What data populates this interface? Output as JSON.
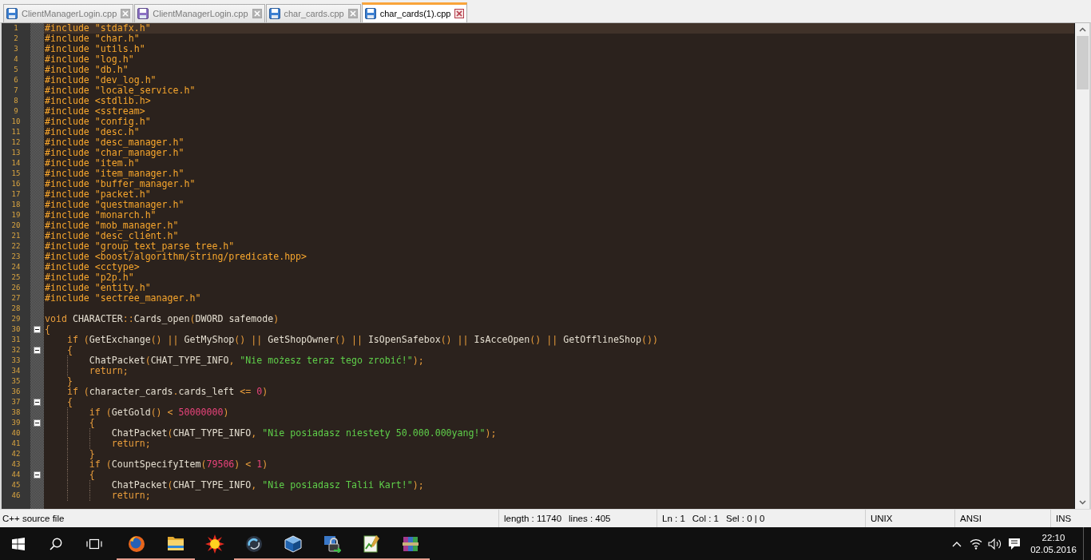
{
  "tabs": [
    {
      "label": "ClientManagerLogin.cpp",
      "selected": false,
      "read_only": false
    },
    {
      "label": "ClientManagerLogin.cpp",
      "selected": false,
      "read_only": true
    },
    {
      "label": "char_cards.cpp",
      "selected": false,
      "read_only": false
    },
    {
      "label": "char_cards(1).cpp",
      "selected": true,
      "read_only": false
    }
  ],
  "editor": {
    "lines": [
      {
        "number": "1",
        "current": true,
        "code": [
          {
            "kind": "preproc",
            "text": "#include \"stdafx.h\""
          }
        ]
      },
      {
        "number": "2",
        "current": false,
        "code": [
          {
            "kind": "preproc",
            "text": "#include \"char.h\""
          }
        ]
      },
      {
        "number": "3",
        "current": false,
        "code": [
          {
            "kind": "preproc",
            "text": "#include \"utils.h\""
          }
        ]
      },
      {
        "number": "4",
        "current": false,
        "code": [
          {
            "kind": "preproc",
            "text": "#include \"log.h\""
          }
        ]
      },
      {
        "number": "5",
        "current": false,
        "code": [
          {
            "kind": "preproc",
            "text": "#include \"db.h\""
          }
        ]
      },
      {
        "number": "6",
        "current": false,
        "code": [
          {
            "kind": "preproc",
            "text": "#include \"dev_log.h\""
          }
        ]
      },
      {
        "number": "7",
        "current": false,
        "code": [
          {
            "kind": "preproc",
            "text": "#include \"locale_service.h\""
          }
        ]
      },
      {
        "number": "8",
        "current": false,
        "code": [
          {
            "kind": "preproc",
            "text": "#include <stdlib.h>"
          }
        ]
      },
      {
        "number": "9",
        "current": false,
        "code": [
          {
            "kind": "preproc",
            "text": "#include <sstream>"
          }
        ]
      },
      {
        "number": "10",
        "current": false,
        "code": [
          {
            "kind": "preproc",
            "text": "#include \"config.h\""
          }
        ]
      },
      {
        "number": "11",
        "current": false,
        "code": [
          {
            "kind": "preproc",
            "text": "#include \"desc.h\""
          }
        ]
      },
      {
        "number": "12",
        "current": false,
        "code": [
          {
            "kind": "preproc",
            "text": "#include \"desc_manager.h\""
          }
        ]
      },
      {
        "number": "13",
        "current": false,
        "code": [
          {
            "kind": "preproc",
            "text": "#include \"char_manager.h\""
          }
        ]
      },
      {
        "number": "14",
        "current": false,
        "code": [
          {
            "kind": "preproc",
            "text": "#include \"item.h\""
          }
        ]
      },
      {
        "number": "15",
        "current": false,
        "code": [
          {
            "kind": "preproc",
            "text": "#include \"item_manager.h\""
          }
        ]
      },
      {
        "number": "16",
        "current": false,
        "code": [
          {
            "kind": "preproc",
            "text": "#include \"buffer_manager.h\""
          }
        ]
      },
      {
        "number": "17",
        "current": false,
        "code": [
          {
            "kind": "preproc",
            "text": "#include \"packet.h\""
          }
        ]
      },
      {
        "number": "18",
        "current": false,
        "code": [
          {
            "kind": "preproc",
            "text": "#include \"questmanager.h\""
          }
        ]
      },
      {
        "number": "19",
        "current": false,
        "code": [
          {
            "kind": "preproc",
            "text": "#include \"monarch.h\""
          }
        ]
      },
      {
        "number": "20",
        "current": false,
        "code": [
          {
            "kind": "preproc",
            "text": "#include \"mob_manager.h\""
          }
        ]
      },
      {
        "number": "21",
        "current": false,
        "code": [
          {
            "kind": "preproc",
            "text": "#include \"desc_client.h\""
          }
        ]
      },
      {
        "number": "22",
        "current": false,
        "code": [
          {
            "kind": "preproc",
            "text": "#include \"group_text_parse_tree.h\""
          }
        ]
      },
      {
        "number": "23",
        "current": false,
        "code": [
          {
            "kind": "preproc",
            "text": "#include <boost/algorithm/string/predicate.hpp>"
          }
        ]
      },
      {
        "number": "24",
        "current": false,
        "code": [
          {
            "kind": "preproc",
            "text": "#include <cctype>"
          }
        ]
      },
      {
        "number": "25",
        "current": false,
        "code": [
          {
            "kind": "preproc",
            "text": "#include \"p2p.h\""
          }
        ]
      },
      {
        "number": "26",
        "current": false,
        "code": [
          {
            "kind": "preproc",
            "text": "#include \"entity.h\""
          }
        ]
      },
      {
        "number": "27",
        "current": false,
        "code": [
          {
            "kind": "preproc",
            "text": "#include \"sectree_manager.h\""
          }
        ]
      },
      {
        "number": "28",
        "current": false
      },
      {
        "number": "29",
        "current": false,
        "code": [
          {
            "kind": "keyword",
            "text": "void"
          },
          {
            "kind": "plain",
            "text": " CHARACTER"
          },
          {
            "kind": "keyword",
            "text": "::"
          },
          {
            "kind": "plain",
            "text": "Cards_open"
          },
          {
            "kind": "keyword",
            "text": "("
          },
          {
            "kind": "plain",
            "text": "DWORD safemode"
          },
          {
            "kind": "keyword",
            "text": ")"
          }
        ]
      },
      {
        "number": "30",
        "current": false,
        "folded": false,
        "code": [
          {
            "kind": "keyword",
            "text": "{"
          }
        ]
      },
      {
        "number": "31",
        "current": false,
        "code": [
          {
            "kind": "keyword",
            "text": "    if ("
          },
          {
            "kind": "plain",
            "text": "GetExchange"
          },
          {
            "kind": "keyword",
            "text": "() || "
          },
          {
            "kind": "plain",
            "text": "GetMyShop"
          },
          {
            "kind": "keyword",
            "text": "() || "
          },
          {
            "kind": "plain",
            "text": "GetShopOwner"
          },
          {
            "kind": "keyword",
            "text": "() || "
          },
          {
            "kind": "plain",
            "text": "IsOpenSafebox"
          },
          {
            "kind": "keyword",
            "text": "() || "
          },
          {
            "kind": "plain",
            "text": "IsAcceOpen"
          },
          {
            "kind": "keyword",
            "text": "() || "
          },
          {
            "kind": "plain",
            "text": "GetOfflineShop"
          },
          {
            "kind": "keyword",
            "text": "())"
          }
        ]
      },
      {
        "number": "32",
        "current": false,
        "folded": false,
        "code": [
          {
            "kind": "keyword",
            "text": "    {"
          }
        ]
      },
      {
        "number": "33",
        "current": false,
        "code": [
          {
            "kind": "plain",
            "text": "        ChatPacket"
          },
          {
            "kind": "keyword",
            "text": "("
          },
          {
            "kind": "plain",
            "text": "CHAT_TYPE_INFO"
          },
          {
            "kind": "keyword",
            "text": ", "
          },
          {
            "kind": "string",
            "text": "\"Nie możesz teraz tego zrobić!\""
          },
          {
            "kind": "keyword",
            "text": ");"
          }
        ]
      },
      {
        "number": "34",
        "current": false,
        "code": [
          {
            "kind": "keyword",
            "text": "        return;"
          }
        ]
      },
      {
        "number": "35",
        "current": false,
        "code": [
          {
            "kind": "keyword",
            "text": "    }"
          }
        ]
      },
      {
        "number": "36",
        "current": false,
        "code": [
          {
            "kind": "keyword",
            "text": "    if ("
          },
          {
            "kind": "plain",
            "text": "character_cards"
          },
          {
            "kind": "keyword",
            "text": "."
          },
          {
            "kind": "plain",
            "text": "cards_left"
          },
          {
            "kind": "keyword",
            "text": " <= "
          },
          {
            "kind": "number",
            "text": "0"
          },
          {
            "kind": "keyword",
            "text": ")"
          }
        ]
      },
      {
        "number": "37",
        "current": false,
        "folded": false,
        "code": [
          {
            "kind": "keyword",
            "text": "    {"
          }
        ]
      },
      {
        "number": "38",
        "current": false,
        "code": [
          {
            "kind": "keyword",
            "text": "        if ("
          },
          {
            "kind": "plain",
            "text": "GetGold"
          },
          {
            "kind": "keyword",
            "text": "() < "
          },
          {
            "kind": "number",
            "text": "50000000"
          },
          {
            "kind": "keyword",
            "text": ")"
          }
        ]
      },
      {
        "number": "39",
        "current": false,
        "folded": false,
        "code": [
          {
            "kind": "keyword",
            "text": "        {"
          }
        ]
      },
      {
        "number": "40",
        "current": false,
        "code": [
          {
            "kind": "plain",
            "text": "            ChatPacket"
          },
          {
            "kind": "keyword",
            "text": "("
          },
          {
            "kind": "plain",
            "text": "CHAT_TYPE_INFO"
          },
          {
            "kind": "keyword",
            "text": ", "
          },
          {
            "kind": "string",
            "text": "\"Nie posiadasz niestety 50.000.000yang!\""
          },
          {
            "kind": "keyword",
            "text": ");"
          }
        ]
      },
      {
        "number": "41",
        "current": false,
        "code": [
          {
            "kind": "keyword",
            "text": "            return;"
          }
        ]
      },
      {
        "number": "42",
        "current": false,
        "code": [
          {
            "kind": "keyword",
            "text": "        }"
          }
        ]
      },
      {
        "number": "43",
        "current": false,
        "code": [
          {
            "kind": "keyword",
            "text": "        if ("
          },
          {
            "kind": "plain",
            "text": "CountSpecifyItem"
          },
          {
            "kind": "keyword",
            "text": "("
          },
          {
            "kind": "number",
            "text": "79506"
          },
          {
            "kind": "keyword",
            "text": ") < "
          },
          {
            "kind": "number",
            "text": "1"
          },
          {
            "kind": "keyword",
            "text": ")"
          }
        ]
      },
      {
        "number": "44",
        "current": false,
        "folded": false,
        "code": [
          {
            "kind": "keyword",
            "text": "        {"
          }
        ]
      },
      {
        "number": "45",
        "current": false,
        "code": [
          {
            "kind": "plain",
            "text": "            ChatPacket"
          },
          {
            "kind": "keyword",
            "text": "("
          },
          {
            "kind": "plain",
            "text": "CHAT_TYPE_INFO"
          },
          {
            "kind": "keyword",
            "text": ", "
          },
          {
            "kind": "string",
            "text": "\"Nie posiadasz Talii Kart!\""
          },
          {
            "kind": "keyword",
            "text": ");"
          }
        ]
      },
      {
        "number": "46",
        "current": false,
        "code": [
          {
            "kind": "keyword",
            "text": "            return;"
          }
        ]
      }
    ]
  },
  "status_bar": {
    "sections": [
      {
        "texts": [
          "C++ source file"
        ]
      },
      {
        "texts": [
          "length : 11740",
          "lines : 405"
        ]
      },
      {
        "texts": [
          "Ln : 1",
          "Col : 1",
          "Sel : 0 | 0"
        ]
      },
      {
        "texts": [
          "UNIX"
        ]
      },
      {
        "texts": [
          "ANSI"
        ]
      },
      {
        "texts": [
          "INS"
        ]
      }
    ]
  },
  "taskbar": {
    "apps": [
      {
        "kind": "browser",
        "running": true
      },
      {
        "kind": "folder",
        "running": true
      },
      {
        "kind": "sun",
        "running": false
      },
      {
        "kind": "swirl",
        "running": true
      },
      {
        "kind": "cube",
        "running": true
      },
      {
        "kind": "padlock",
        "running": true
      },
      {
        "kind": "chart",
        "running": true
      },
      {
        "kind": "books",
        "running": true
      }
    ],
    "clock": {
      "time": "22:10",
      "date": "02.05.2016"
    }
  }
}
